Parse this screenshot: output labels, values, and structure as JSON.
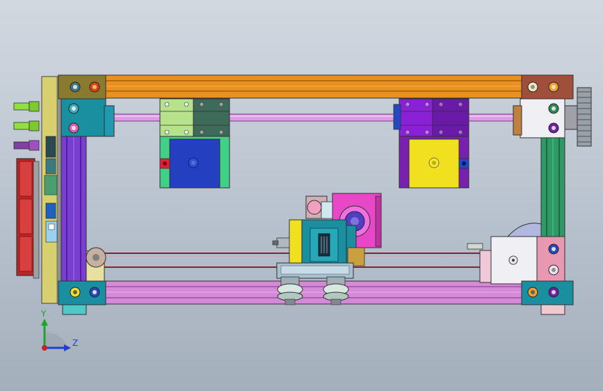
{
  "viewport": {
    "name": "cad-model-view",
    "background_top": "#d2d8e0",
    "background_bottom": "#a4afbc"
  },
  "triad": {
    "y_label": "Y",
    "z_label": "Z",
    "y_color": "#1fa32a",
    "z_color": "#1e3fd6",
    "x_color": "#c8202a"
  },
  "colors": {
    "frame_orange": "#e89020",
    "frame_pink": "#d58ad8",
    "frame_violet": "#7a3fd0",
    "frame_green": "#2f9a66",
    "rod": "#e09ae8",
    "motor_blue": "#2440c0",
    "motor_yellow": "#f0e020",
    "block_purple": "#8a20d8",
    "block_lime": "#b6e28c",
    "corner_white": "#f0f0f4",
    "teal": "#1a8fa0"
  }
}
